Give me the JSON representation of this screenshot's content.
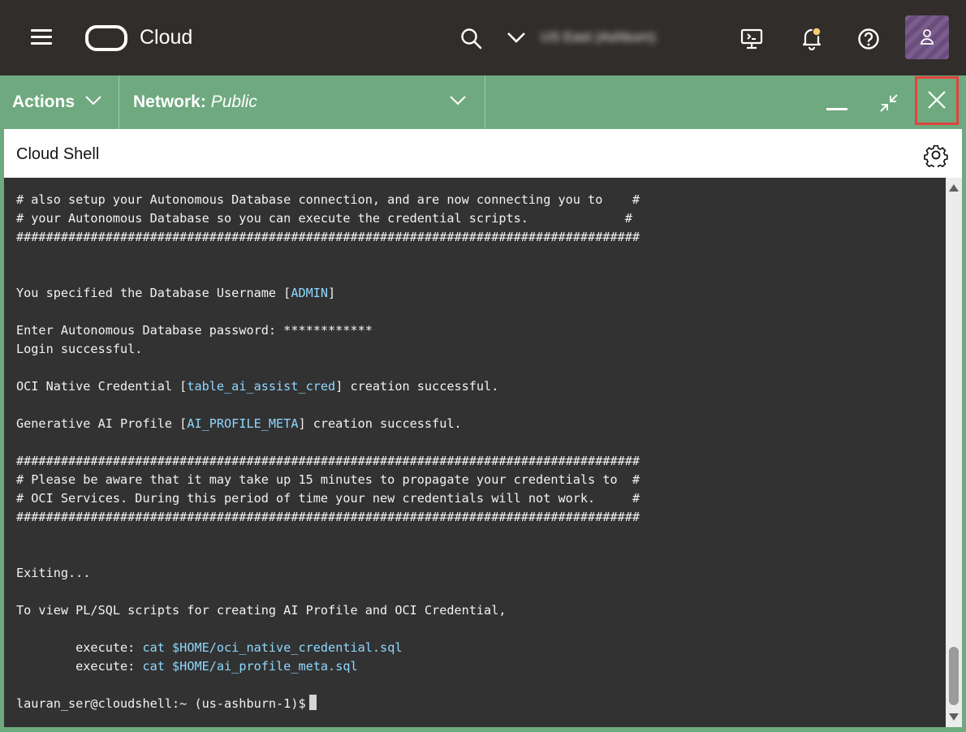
{
  "header": {
    "brand": "Cloud",
    "region_label": "US East (Ashburn)"
  },
  "shell": {
    "actions_label": "Actions",
    "network_label": "Network:",
    "network_value": "Public",
    "title": "Cloud Shell"
  },
  "terminal": {
    "lines": [
      [
        {
          "t": "# also setup your Autonomous Database connection, and are now connecting you to    #"
        }
      ],
      [
        {
          "t": "# your Autonomous Database so you can execute the credential scripts.             #"
        }
      ],
      [
        {
          "t": "####################################################################################"
        }
      ],
      [
        {
          "t": ""
        }
      ],
      [
        {
          "t": ""
        }
      ],
      [
        {
          "t": "You specified the Database Username ["
        },
        {
          "t": "ADMIN",
          "h": true
        },
        {
          "t": "]"
        }
      ],
      [
        {
          "t": ""
        }
      ],
      [
        {
          "t": "Enter Autonomous Database password: ************"
        }
      ],
      [
        {
          "t": "Login successful."
        }
      ],
      [
        {
          "t": ""
        }
      ],
      [
        {
          "t": "OCI Native Credential ["
        },
        {
          "t": "table_ai_assist_cred",
          "h": true
        },
        {
          "t": "] creation successful."
        }
      ],
      [
        {
          "t": ""
        }
      ],
      [
        {
          "t": "Generative AI Profile ["
        },
        {
          "t": "AI_PROFILE_META",
          "h": true
        },
        {
          "t": "] creation successful."
        }
      ],
      [
        {
          "t": ""
        }
      ],
      [
        {
          "t": "####################################################################################"
        }
      ],
      [
        {
          "t": "# Please be aware that it may take up 15 minutes to propagate your credentials to  #"
        }
      ],
      [
        {
          "t": "# OCI Services. During this period of time your new credentials will not work.     #"
        }
      ],
      [
        {
          "t": "####################################################################################"
        }
      ],
      [
        {
          "t": ""
        }
      ],
      [
        {
          "t": ""
        }
      ],
      [
        {
          "t": "Exiting..."
        }
      ],
      [
        {
          "t": ""
        }
      ],
      [
        {
          "t": "To view PL/SQL scripts for creating AI Profile and OCI Credential,"
        }
      ],
      [
        {
          "t": ""
        }
      ],
      [
        {
          "t": "        execute: "
        },
        {
          "t": "cat $HOME/oci_native_credential.sql",
          "h": true
        }
      ],
      [
        {
          "t": "        execute: "
        },
        {
          "t": "cat $HOME/ai_profile_meta.sql",
          "h": true
        }
      ],
      [
        {
          "t": ""
        }
      ]
    ],
    "prompt": "lauran_ser@cloudshell:~ (us-ashburn-1)$"
  },
  "icons": {
    "menu": "hamburger-icon",
    "search": "search-icon",
    "dropdown": "chevron-down-icon",
    "cloud_shell": "cloud-shell-icon",
    "notifications": "bell-icon",
    "help": "help-icon",
    "profile": "user-icon",
    "minimize": "minimize-icon",
    "restore": "restore-icon",
    "close": "close-icon",
    "settings": "gear-icon"
  },
  "colors": {
    "header_bg": "#312d2a",
    "shell_toolbar": "#6fa97f",
    "terminal_bg": "#323232",
    "terminal_highlight": "#8fd8ff",
    "close_highlight_border": "#e0443d",
    "notification_dot": "#f3cf6d"
  }
}
